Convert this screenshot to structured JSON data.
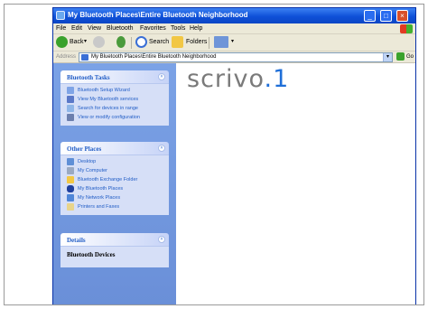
{
  "window": {
    "title": "My Bluetooth Places\\Entire Bluetooth Neighborhood",
    "controls": {
      "minimize": "_",
      "maximize": "□",
      "close": "×"
    }
  },
  "menu": [
    "File",
    "Edit",
    "View",
    "Bluetooth",
    "Favorites",
    "Tools",
    "Help"
  ],
  "toolbar": {
    "back": "Back",
    "search": "Search",
    "folders": "Folders",
    "dropdown": "▾"
  },
  "address": {
    "label": "Address",
    "value": "My Bluetooth Places\\Entire Bluetooth Neighborhood",
    "go": "Go"
  },
  "bluetooth_tasks": {
    "title": "Bluetooth Tasks",
    "items": [
      "Bluetooth Setup Wizard",
      "View My Bluetooth services",
      "Search for devices in range",
      "View or modify configuration"
    ]
  },
  "other_places": {
    "title": "Other Places",
    "items": [
      "Desktop",
      "My Computer",
      "Bluetooth Exchange Folder",
      "My Bluetooth Places",
      "My Network Places",
      "Printers and Faxes"
    ]
  },
  "details": {
    "title": "Details",
    "text": "Bluetooth Devices"
  },
  "content": {
    "logo_text": "scrivo",
    "logo_number": ".1"
  },
  "colors": {
    "title_bar": "#0e50d8",
    "task_pane": "#7ba2e6",
    "link": "#215dc6",
    "logo_grey": "#7a7a7a",
    "logo_blue": "#1f6fd8"
  }
}
